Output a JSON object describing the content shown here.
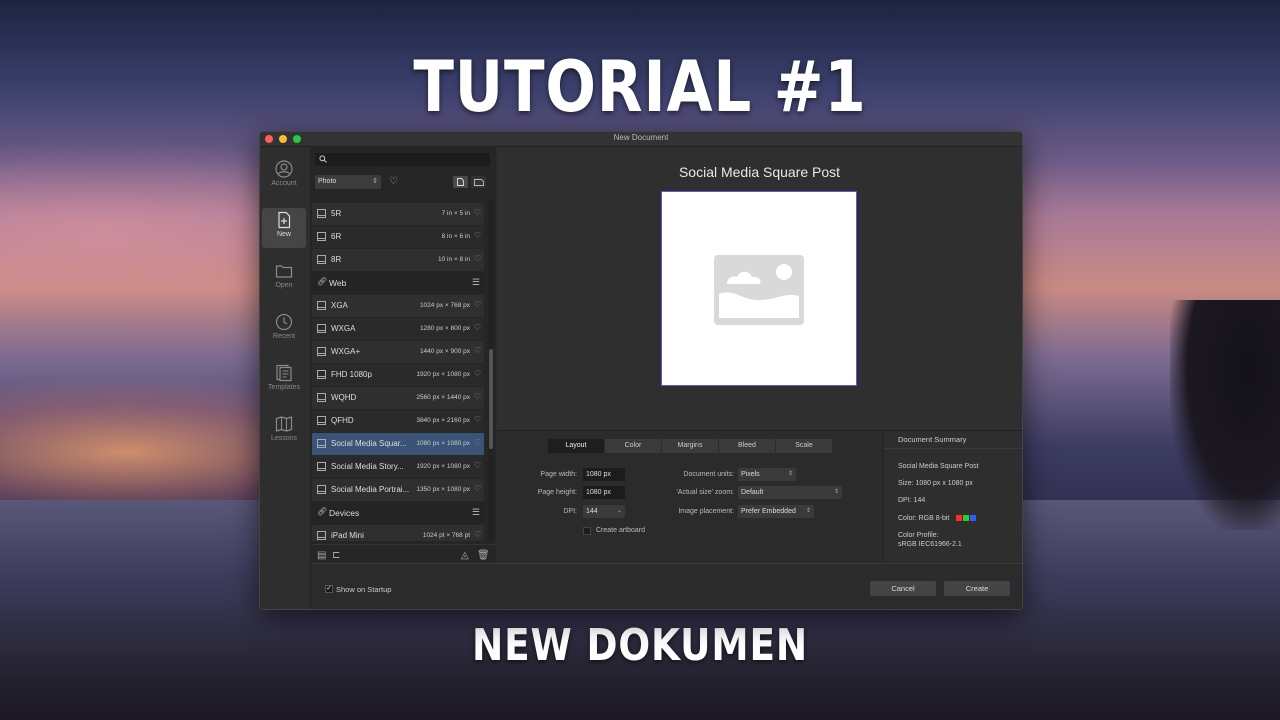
{
  "overlay": {
    "title_top": "TUTORIAL #1",
    "title_bottom": "NEW DOKUMEN"
  },
  "window": {
    "title": "New Document"
  },
  "sidenav": {
    "items": [
      {
        "label": "Account",
        "icon": "account-icon"
      },
      {
        "label": "New",
        "icon": "new-document-icon"
      },
      {
        "label": "Open",
        "icon": "folder-icon"
      },
      {
        "label": "Recent",
        "icon": "recent-icon"
      },
      {
        "label": "Templates",
        "icon": "templates-icon"
      },
      {
        "label": "Lessons",
        "icon": "lessons-icon"
      }
    ]
  },
  "presets": {
    "search_placeholder": "",
    "category": "Photo",
    "rows": [
      {
        "name": "5R",
        "size": "7 in × 5 in"
      },
      {
        "name": "6R",
        "size": "8 in × 6 in"
      },
      {
        "name": "8R",
        "size": "10 in × 8 in"
      }
    ],
    "web_section": "Web",
    "web_rows": [
      {
        "name": "XGA",
        "size": "1024 px × 768 px"
      },
      {
        "name": "WXGA",
        "size": "1280 px × 800 px"
      },
      {
        "name": "WXGA+",
        "size": "1440 px × 900 px"
      },
      {
        "name": "FHD 1080p",
        "size": "1920 px × 1080 px"
      },
      {
        "name": "WQHD",
        "size": "2560 px × 1440 px"
      },
      {
        "name": "QFHD",
        "size": "3840 px × 2160 px"
      },
      {
        "name": "Social Media Squar...",
        "size": "1080 px × 1080 px"
      },
      {
        "name": "Social Media Story...",
        "size": "1920 px × 1080 px"
      },
      {
        "name": "Social Media Portrai...",
        "size": "1350 px × 1080 px"
      }
    ],
    "devices_section": "Devices",
    "device_rows": [
      {
        "name": "iPad Mini",
        "size": "1024 pt × 768 pt"
      }
    ]
  },
  "preview": {
    "title": "Social Media Square Post"
  },
  "tabs": [
    "Layout",
    "Color",
    "Margins",
    "Bleed",
    "Scale"
  ],
  "layout": {
    "page_width_label": "Page width:",
    "page_width": "1080 px",
    "page_height_label": "Page height:",
    "page_height": "1080 px",
    "dpi_label": "DPI:",
    "dpi": "144",
    "units_label": "Document units:",
    "units": "Pixels",
    "zoom_label": "'Actual size' zoom:",
    "zoom": "Default",
    "placement_label": "Image placement:",
    "placement": "Prefer Embedded",
    "artboard_label": "Create artboard"
  },
  "summary": {
    "header": "Document Summary",
    "name": "Social Media Square Post",
    "size": "Size: 1080 px x 1080 px",
    "dpi": "DPI:  144",
    "color": "Color: RGB 8-bit",
    "profile_label": "Color Profile:",
    "profile": "sRGB IEC61966-2.1",
    "swatch_colors": [
      "#ff2a2a",
      "#2ad12a",
      "#2a5cff"
    ]
  },
  "footer": {
    "show_on_startup": "Show on Startup",
    "show_on_startup_checked": true,
    "cancel": "Cancel",
    "create": "Create"
  }
}
